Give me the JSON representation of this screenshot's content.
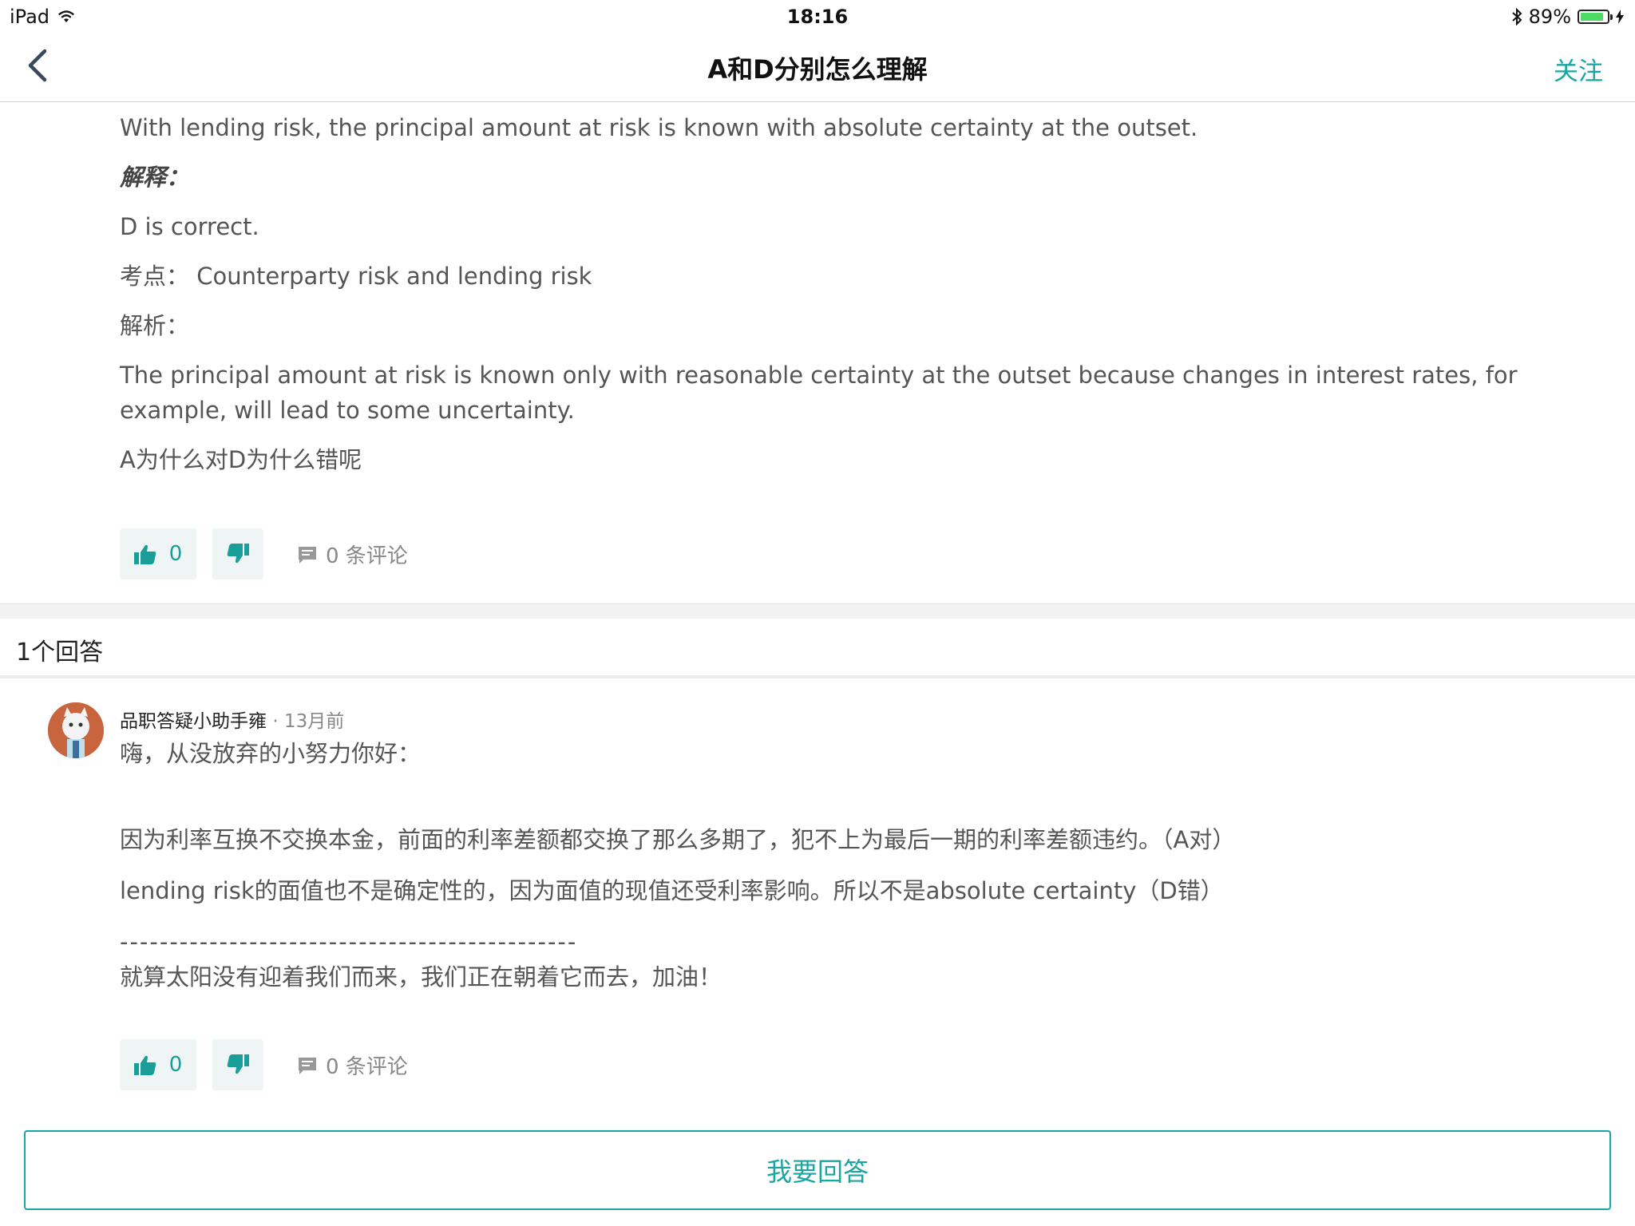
{
  "status_bar": {
    "device": "iPad",
    "time": "18:16",
    "battery": "89%",
    "battery_level": 0.89
  },
  "navbar": {
    "title": "A和D分别怎么理解",
    "follow_label": "关注"
  },
  "question": {
    "lines": [
      "With lending risk, the principal amount at risk is known with absolute certainty at the outset.",
      "解释：",
      "D is correct.",
      "考点： Counterparty risk and lending risk",
      "解析：",
      "The principal amount at risk is known only with reasonable certainty at the outset because changes in interest rates, for example, will lead to some uncertainty.",
      "A为什么对D为什么错呢"
    ],
    "upvotes": "0",
    "comments": "0 条评论"
  },
  "answers_header": "1个回答",
  "answer": {
    "author": "品职答疑小助手雍",
    "time": "· 13月前",
    "lines": [
      "嗨，从没放弃的小努力你好：",
      "",
      "因为利率互换不交换本金，前面的利率差额都交换了那么多期了，犯不上为最后一期的利率差额违约。（A对）",
      "lending risk的面值也不是确定性的，因为面值的现值还受利率影响。所以不是absolute certainty（D错）",
      "----------------------------------------------",
      "就算太阳没有迎着我们而来，我们正在朝着它而去，加油！"
    ],
    "upvotes": "0",
    "comments": "0 条评论"
  },
  "reply_button": "我要回答",
  "colors": {
    "accent": "#1aa6a2",
    "vote_bg": "#eef5f4"
  }
}
